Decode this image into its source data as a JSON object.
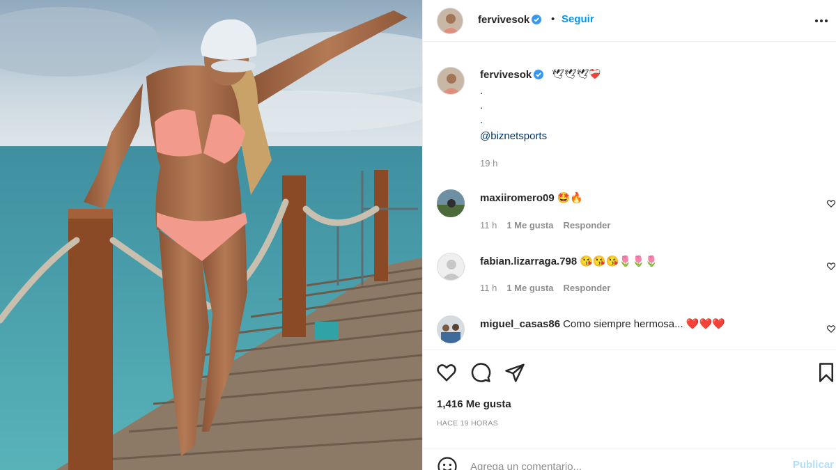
{
  "post": {
    "author": "fervivesok",
    "follow_label": "Seguir",
    "header_separator": "•",
    "more_icon": "more-options-icon",
    "verified_color": "#3897f0",
    "accent_color": "#0095f6"
  },
  "caption": {
    "username": "fervivesok",
    "emojis": "🕊🕊🕊❤️‍🩹",
    "lines": [
      ".",
      ".",
      "."
    ],
    "mention": "@biznetsports",
    "time": "19 h"
  },
  "comments": [
    {
      "username": "maxiiromero09",
      "text": "🤩🔥",
      "time": "11 h",
      "likes": "1 Me gusta",
      "reply": "Responder"
    },
    {
      "username": "fabian.lizarraga.798",
      "text": "😘😘😘🌷🌷🌷",
      "time": "11 h",
      "likes": "1 Me gusta",
      "reply": "Responder"
    },
    {
      "username": "miguel_casas86",
      "text": "Como siempre hermosa... ❤️❤️❤️"
    }
  ],
  "actions": {
    "like_icon": "heart-icon",
    "comment_icon": "comment-bubble-icon",
    "share_icon": "paper-plane-icon",
    "save_icon": "bookmark-icon"
  },
  "likes_label": "1,416 Me gusta",
  "posted_ago": "HACE 19 HORAS",
  "add_comment": {
    "placeholder": "Agrega un comentario...",
    "publish_label": "Publicar",
    "publish_color": "#b2dffc"
  }
}
